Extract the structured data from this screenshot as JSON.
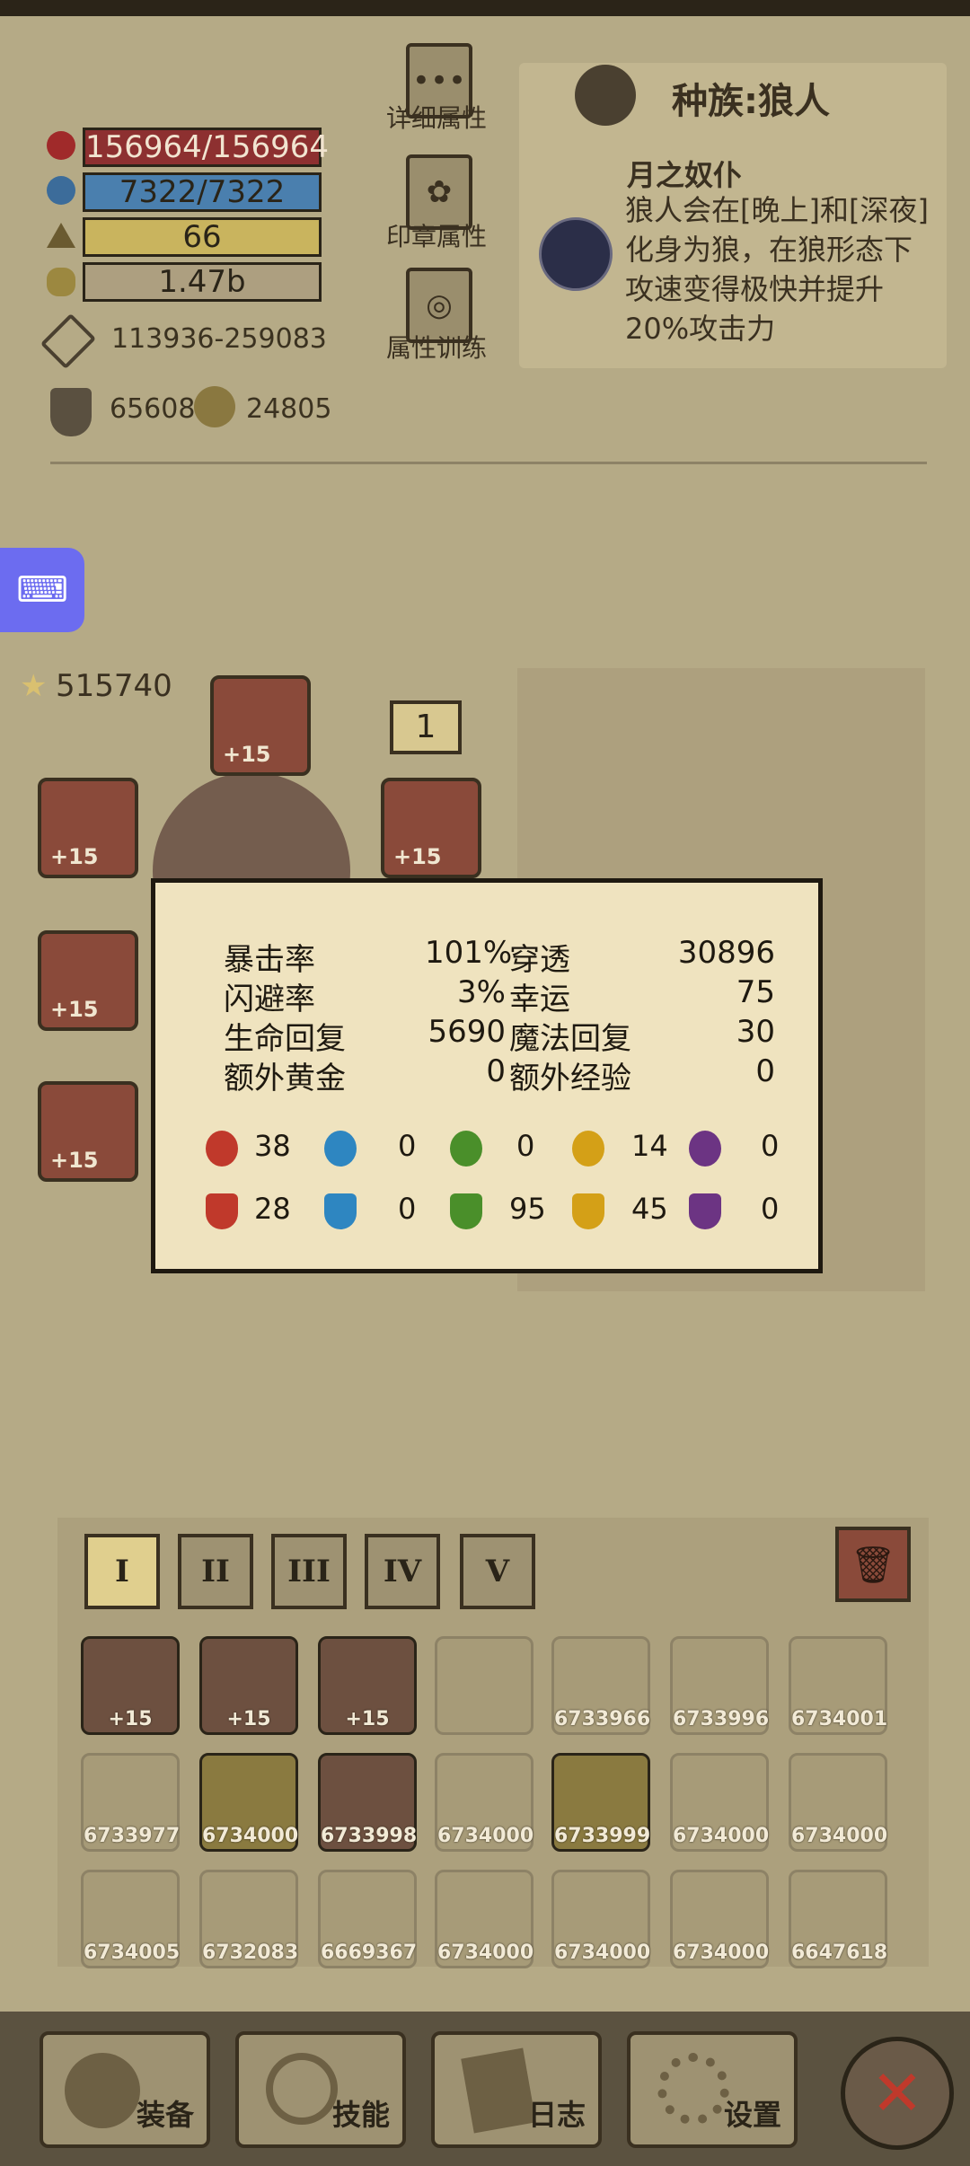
{
  "stats": {
    "hp": "156964/156964",
    "mp": "7322/7322",
    "level": "66",
    "gold": "1.47b",
    "attack": "113936-259083",
    "armor": "65608",
    "armor2": "24805"
  },
  "side_buttons": {
    "detail": "详细属性",
    "seal": "印章属性",
    "training": "属性训练"
  },
  "race": {
    "title": "种族:狼人",
    "trait_title": "月之奴仆",
    "trait_desc": "狼人会在[晚上]和[深夜]化身为狼，在狼形态下攻速变得极快并提升20%攻击力"
  },
  "score": "515740",
  "equip_count": "1",
  "equipment_slots": [
    "+15",
    "+15",
    "+15",
    "+15",
    "+15",
    "+15"
  ],
  "popup": {
    "rows": [
      {
        "l": "暴击率",
        "lv": "101%",
        "r": "穿透",
        "rv": "30896"
      },
      {
        "l": "闪避率",
        "lv": "3%",
        "r": "幸运",
        "rv": "75"
      },
      {
        "l": "生命回复",
        "lv": "5690",
        "r": "魔法回复",
        "rv": "30"
      },
      {
        "l": "额外黄金",
        "lv": "0",
        "r": "额外经验",
        "rv": "0"
      }
    ],
    "attack_elements": [
      "38",
      "0",
      "0",
      "14",
      "0"
    ],
    "defense_elements": [
      "28",
      "0",
      "95",
      "45",
      "0"
    ],
    "element_colors": [
      "#c0392b",
      "#2e86c1",
      "#4a8f2a",
      "#d4a017",
      "#6c3483"
    ]
  },
  "tabs": [
    "I",
    "II",
    "III",
    "IV",
    "V"
  ],
  "inventory": [
    [
      "+15",
      "+15",
      "+15",
      "",
      "6733966",
      "6733996",
      "6734001"
    ],
    [
      "6733977",
      "6734000",
      "6733998",
      "6734000",
      "6733999",
      "6734000",
      "6734000"
    ],
    [
      "6734005",
      "6732083",
      "6669367",
      "6734000",
      "6734000",
      "6734000",
      "6647618"
    ]
  ],
  "nav": [
    "装备",
    "技能",
    "日志",
    "设置"
  ]
}
